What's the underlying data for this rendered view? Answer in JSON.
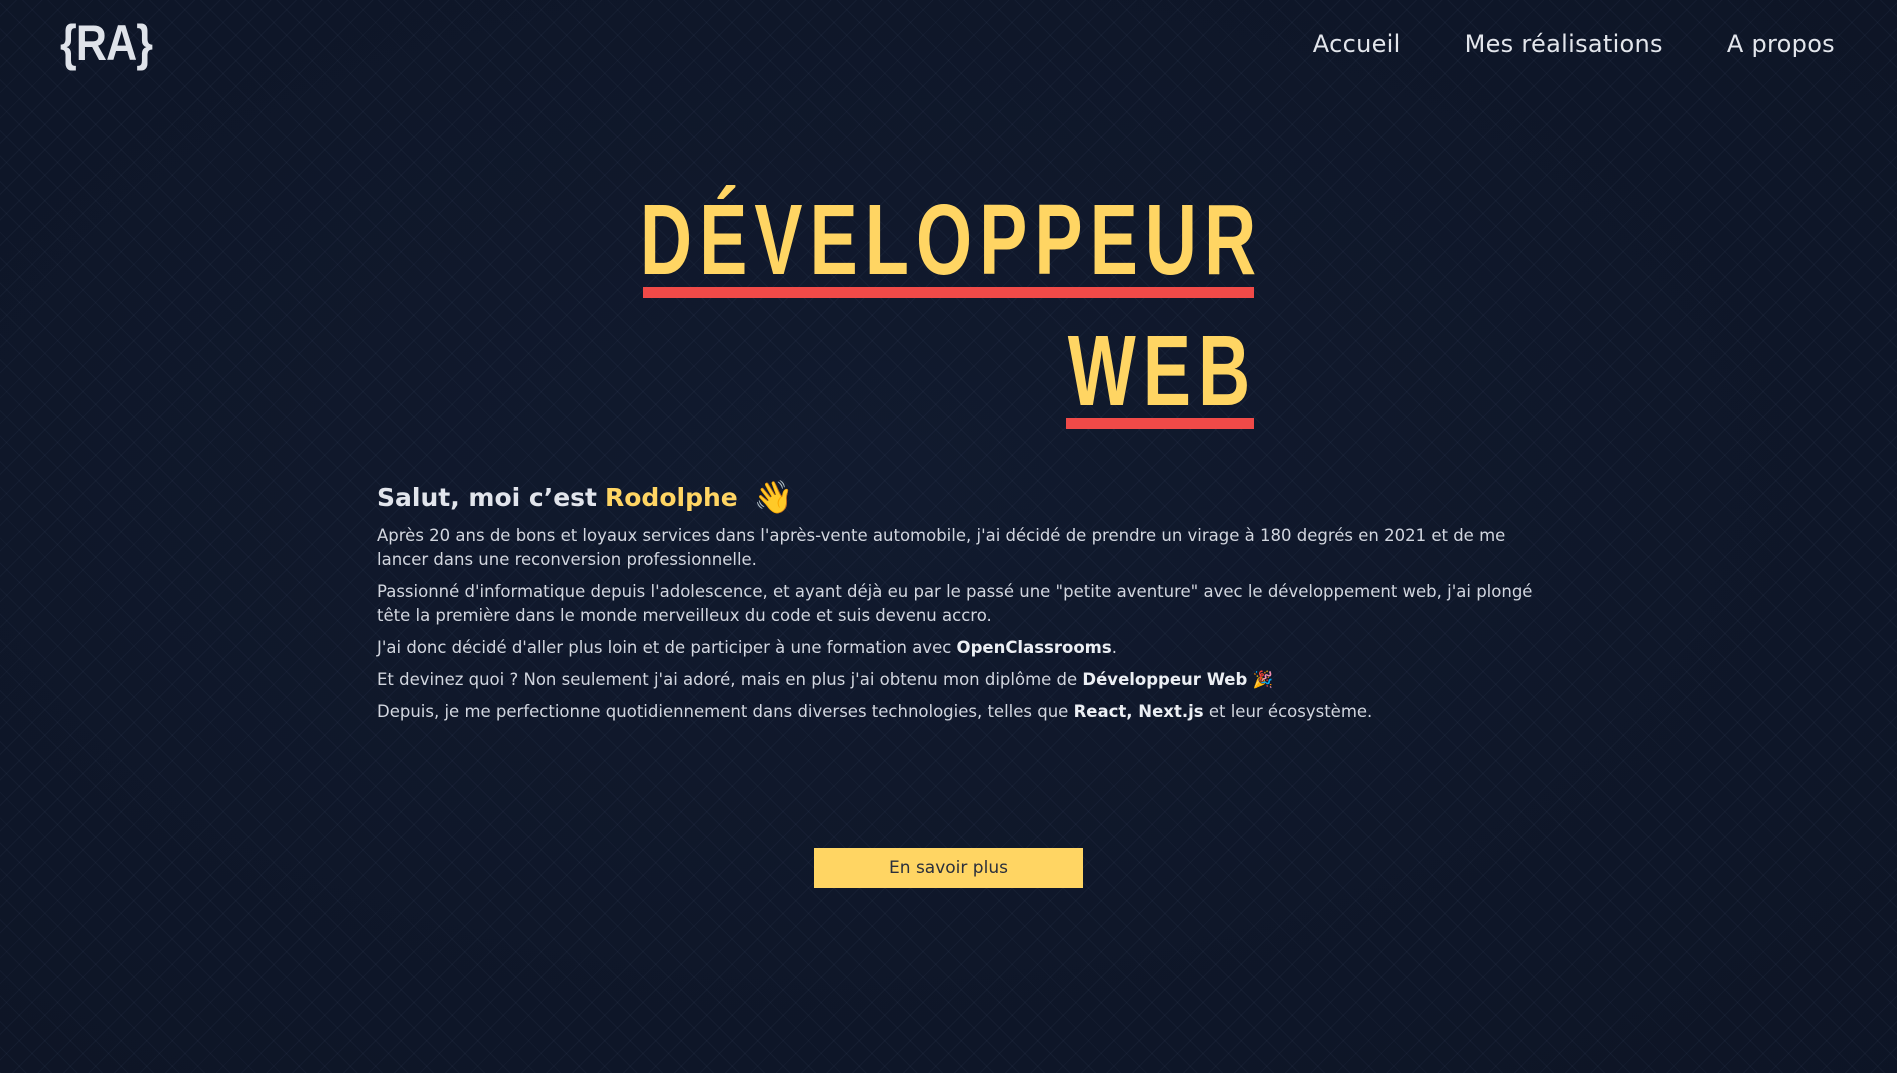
{
  "header": {
    "logo": "{RA}",
    "nav": [
      "Accueil",
      "Mes réalisations",
      "A propos"
    ]
  },
  "hero": {
    "line1": "DÉVELOPPEUR",
    "line2": "WEB"
  },
  "intro": {
    "greeting_prefix": "Salut, moi c’est",
    "greeting_name": "Rodolphe",
    "greeting_emoji": "👋",
    "p1": "Après 20 ans de bons et loyaux services dans l'après-vente automobile, j'ai décidé de prendre un virage à 180 degrés en 2021 et de me lancer dans une reconversion professionnelle.",
    "p2": "Passionné d'informatique depuis l'adolescence, et ayant déjà eu par le passé une \"petite aventure\" avec le développement web, j'ai plongé tête la première dans le monde merveilleux du code et suis devenu accro.",
    "p3_prefix": "J'ai donc décidé d'aller plus loin et de participer à une formation avec",
    "p3_bold": "OpenClassrooms",
    "p3_suffix": ".",
    "p4_prefix": "Et devinez quoi ? Non seulement j'ai adoré, mais en plus j'ai obtenu mon diplôme de",
    "p4_bold": "Développeur Web",
    "p4_emoji": "🎉",
    "p5_prefix": "Depuis, je me perfectionne quotidiennement dans diverses technologies, telles que",
    "p5_bold": "React, Next.js",
    "p5_suffix": "et leur écosystème."
  },
  "cta": {
    "label": "En savoir plus"
  },
  "colors": {
    "background": "#111a2e",
    "accent_yellow": "#ffd563",
    "accent_red": "#f04a48",
    "text": "#d2d6df"
  }
}
